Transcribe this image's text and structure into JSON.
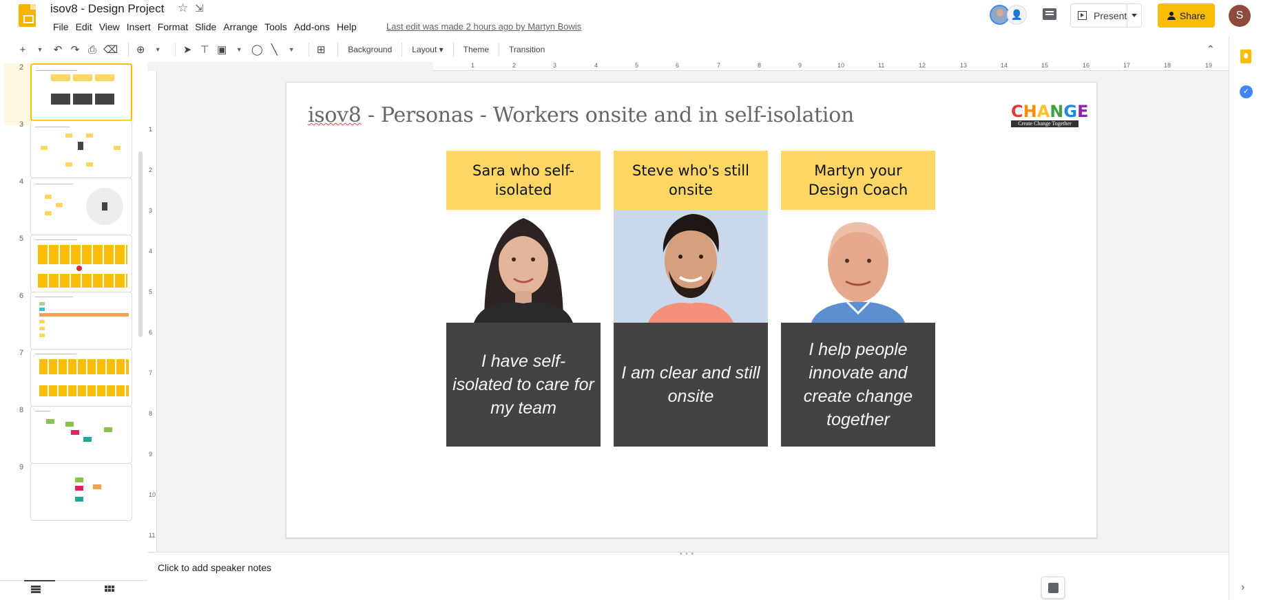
{
  "header": {
    "doc_title": "isov8 - Design Project",
    "menu": [
      "File",
      "Edit",
      "View",
      "Insert",
      "Format",
      "Slide",
      "Arrange",
      "Tools",
      "Add-ons",
      "Help"
    ],
    "last_edit": "Last edit was made 2 hours ago by Martyn Bowis",
    "present_label": "Present",
    "share_label": "Share",
    "account_initial": "S"
  },
  "toolbar": {
    "background_label": "Background",
    "layout_label": "Layout",
    "theme_label": "Theme",
    "transition_label": "Transition"
  },
  "filmstrip": {
    "slide_numbers": [
      "2",
      "3",
      "4",
      "5",
      "6",
      "7",
      "8",
      "9"
    ],
    "active_slide": "2"
  },
  "rulers": {
    "horizontal": [
      "1",
      "2",
      "3",
      "4",
      "5",
      "6",
      "7",
      "8",
      "9",
      "10",
      "11",
      "12",
      "13",
      "14",
      "15",
      "16",
      "17",
      "18",
      "19"
    ],
    "vertical": [
      "1",
      "2",
      "3",
      "4",
      "5",
      "6",
      "7",
      "8",
      "9",
      "10",
      "11"
    ]
  },
  "slide": {
    "title_prefix": "isov8",
    "title_rest": " - Personas - Workers onsite and in self-isolation",
    "brand_letters": [
      "C",
      "H",
      "A",
      "N",
      "G",
      "E"
    ],
    "brand_tagline": "Create Change Together",
    "personas": [
      {
        "name": "Sara who self-isolated",
        "quote": "I have self-isolated to care for my team"
      },
      {
        "name": "Steve who's still onsite",
        "quote": "I am clear and still onsite"
      },
      {
        "name": "Martyn your Design Coach",
        "quote": "I help people innovate and create change together"
      }
    ]
  },
  "notes": {
    "placeholder": "Click to add speaker notes"
  },
  "colors": {
    "accent_yellow": "#fbbc04",
    "sticky_yellow": "#fdd663",
    "quote_dark": "#434343"
  }
}
